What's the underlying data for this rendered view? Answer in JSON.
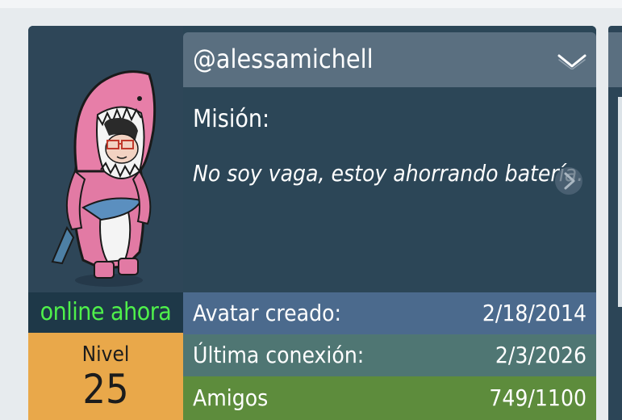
{
  "profile": {
    "username": "@alessamichell",
    "motto_label": "Misión:",
    "motto": "No soy vaga, estoy ahorrando batería.",
    "status": "online ahora",
    "level_label": "Nivel",
    "level_value": "25"
  },
  "stats": {
    "created_label": "Avatar creado:",
    "created_value": "2/18/2014",
    "last_connection_label": "Última conexión:",
    "last_connection_value": "2/3/2026",
    "friends_label": "Amigos",
    "friends_value": "749/1100"
  },
  "icons": {
    "dropdown": "chevron-down-icon",
    "motto_info": "circle-arrow-icon",
    "avatar": "shark-costume-avatar"
  },
  "colors": {
    "online_text": "#4ff04b",
    "level_bg": "#e9a84a",
    "created_row": "#4b6a8d",
    "last_connection_row": "#4f7673",
    "friends_row": "#5d8c3c"
  }
}
